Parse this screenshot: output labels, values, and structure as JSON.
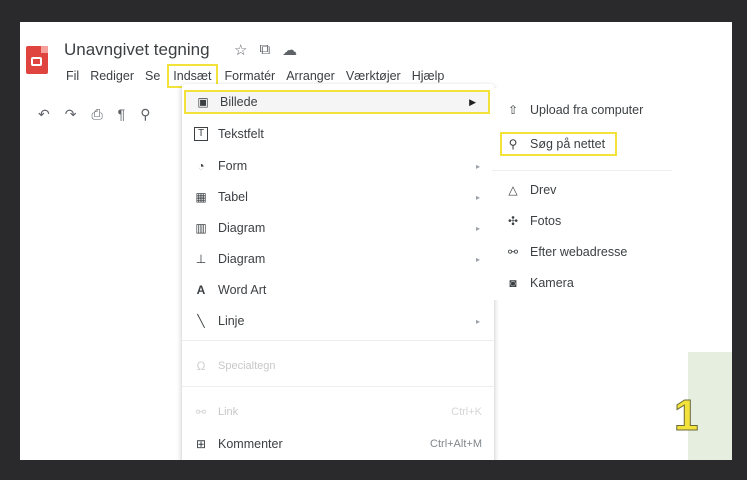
{
  "app": {
    "title": "Unavngivet tegning",
    "logo_icon": "drawings-logo-icon"
  },
  "title_icons": [
    {
      "name": "star-icon",
      "glyph": "☆"
    },
    {
      "name": "move-to-folder-icon",
      "glyph": "⧉"
    },
    {
      "name": "cloud-status-icon",
      "glyph": "☁"
    }
  ],
  "menubar": [
    "Fil",
    "Rediger",
    "Se",
    "Indsæt",
    "Formatér",
    "Arranger",
    "Værktøjer",
    "Hjælp"
  ],
  "menubar_active": "Indsæt",
  "toolbar": [
    {
      "name": "undo-icon",
      "glyph": "↶"
    },
    {
      "name": "redo-icon",
      "glyph": "↷"
    },
    {
      "name": "print-icon",
      "glyph": "⎙"
    },
    {
      "name": "paint-format-icon",
      "glyph": "¶"
    },
    {
      "name": "zoom-icon",
      "glyph": "⚲"
    }
  ],
  "insert_menu": {
    "items": [
      {
        "label": "Billede",
        "icon": "image-icon",
        "glyph": "▣",
        "arrow": "▶",
        "highlight": true
      },
      {
        "label": "Tekstfelt",
        "icon": "textbox-icon",
        "glyph": "T"
      },
      {
        "label": "Form",
        "icon": "shape-icon",
        "glyph": "◔",
        "arrow": "▸"
      },
      {
        "label": "Tabel",
        "icon": "table-icon",
        "glyph": "▦",
        "arrow": "▸"
      },
      {
        "label": "Diagram",
        "icon": "chart-icon",
        "glyph": "▥",
        "arrow": "▸"
      },
      {
        "label": "Diagram",
        "icon": "diagram-icon",
        "glyph": "⊥",
        "arrow": "▸"
      },
      {
        "label": "Word Art",
        "icon": "word-art-icon",
        "glyph": "A"
      },
      {
        "label": "Linje",
        "icon": "line-icon",
        "glyph": "╲",
        "arrow": "▸"
      },
      {
        "label": "Specialtegn",
        "icon": "special-chars-icon",
        "glyph": "Ω",
        "disabled": true
      },
      {
        "label": "Link",
        "icon": "link-icon",
        "glyph": "⚯",
        "shortcut": "Ctrl+K",
        "disabled": true
      },
      {
        "label": "Kommenter",
        "icon": "comment-icon",
        "glyph": "⊞",
        "shortcut": "Ctrl+Alt+M"
      }
    ]
  },
  "image_submenu": {
    "items": [
      {
        "label": "Upload fra computer",
        "icon": "upload-icon",
        "glyph": "⇧"
      },
      {
        "label": "Søg på nettet",
        "icon": "search-icon",
        "glyph": "⚲",
        "highlight": true
      },
      {
        "label": "Drev",
        "icon": "drive-icon",
        "glyph": "△"
      },
      {
        "label": "Fotos",
        "icon": "photos-icon",
        "glyph": "✣"
      },
      {
        "label": "Efter webadresse",
        "icon": "link-icon",
        "glyph": "⚯"
      },
      {
        "label": "Kamera",
        "icon": "camera-icon",
        "glyph": "◙"
      }
    ]
  },
  "step_number": "1",
  "colors": {
    "highlight": "#f2e23a",
    "logo": "#e0443e",
    "panel": "#e6eedf"
  }
}
